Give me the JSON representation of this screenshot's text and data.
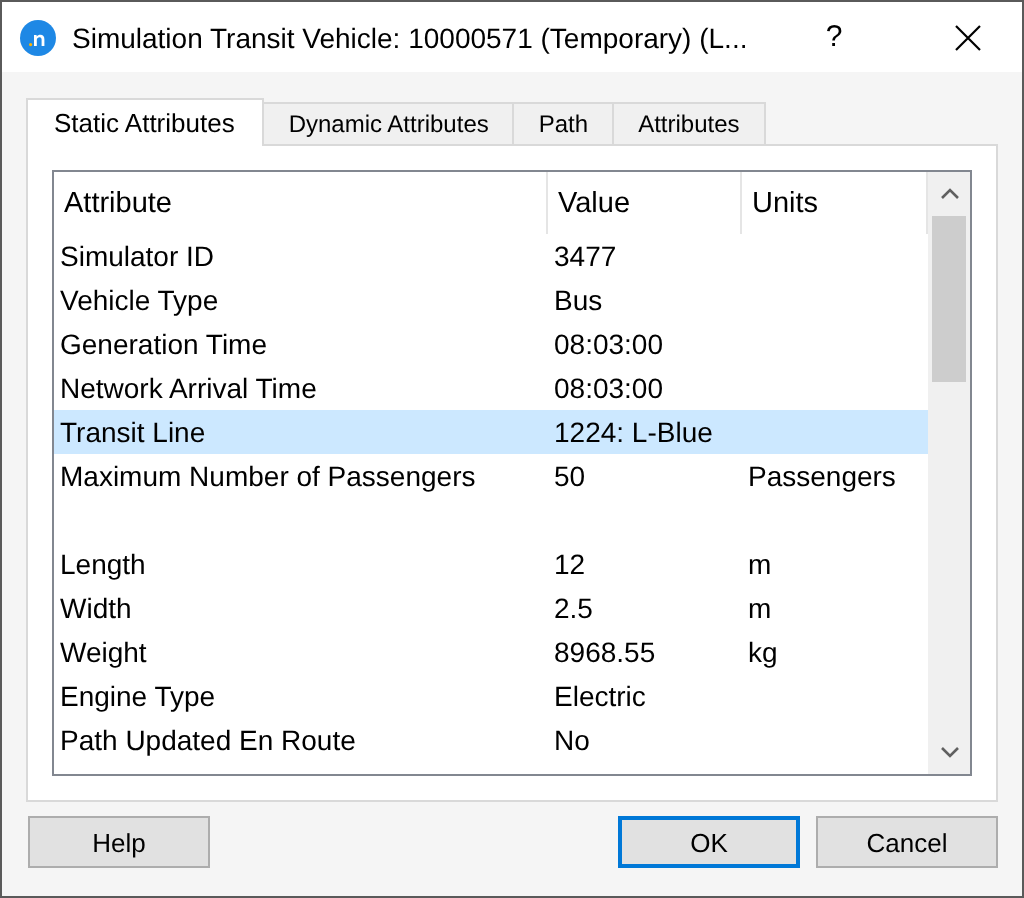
{
  "window": {
    "title": "Simulation Transit Vehicle: 10000571 (Temporary) (L...",
    "help_glyph": "?"
  },
  "tabs": [
    {
      "label": "Static Attributes",
      "selected": true
    },
    {
      "label": "Dynamic Attributes",
      "selected": false
    },
    {
      "label": "Path",
      "selected": false
    },
    {
      "label": "Attributes",
      "selected": false
    }
  ],
  "table": {
    "columns": [
      "Attribute",
      "Value",
      "Units"
    ],
    "rows": [
      {
        "kind": "data",
        "cells": [
          "Simulator ID",
          "3477",
          ""
        ],
        "selected": false
      },
      {
        "kind": "data",
        "cells": [
          "Vehicle Type",
          "Bus",
          ""
        ],
        "selected": false
      },
      {
        "kind": "data",
        "cells": [
          "Generation Time",
          "08:03:00",
          ""
        ],
        "selected": false
      },
      {
        "kind": "data",
        "cells": [
          "Network Arrival Time",
          "08:03:00",
          ""
        ],
        "selected": false
      },
      {
        "kind": "data",
        "cells": [
          "Transit Line",
          "1224: L-Blue",
          ""
        ],
        "selected": true
      },
      {
        "kind": "data",
        "cells": [
          "Maximum Number of Passengers",
          "50",
          "Passengers"
        ],
        "selected": false
      },
      {
        "kind": "spacer"
      },
      {
        "kind": "data",
        "cells": [
          "Length",
          "12",
          "m"
        ],
        "selected": false
      },
      {
        "kind": "data",
        "cells": [
          "Width",
          "2.5",
          "m"
        ],
        "selected": false
      },
      {
        "kind": "data",
        "cells": [
          "Weight",
          "8968.55",
          "kg"
        ],
        "selected": false
      },
      {
        "kind": "data",
        "cells": [
          "Engine Type",
          "Electric",
          ""
        ],
        "selected": false
      },
      {
        "kind": "data",
        "cells": [
          "Path Updated En Route",
          "No",
          ""
        ],
        "selected": false
      }
    ]
  },
  "buttons": [
    {
      "label": "Help",
      "default": false
    },
    {
      "label": "OK",
      "default": true
    },
    {
      "label": "Cancel",
      "default": false
    }
  ]
}
